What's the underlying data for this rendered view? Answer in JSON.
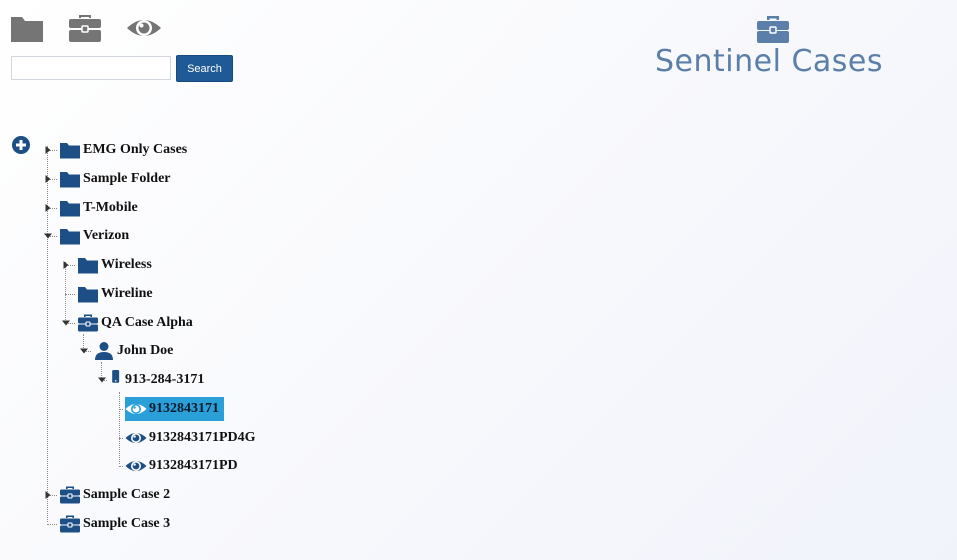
{
  "toolbar": {
    "icons": [
      "folder-icon",
      "briefcase-icon",
      "eye-icon"
    ]
  },
  "search": {
    "value": "",
    "placeholder": "",
    "button_label": "Search"
  },
  "brand": {
    "icon": "briefcase-icon",
    "title": "Sentinel Cases"
  },
  "colors": {
    "accent": "#1f5a96",
    "node_icon": "#1d4f86",
    "toolbar_icon": "#757575",
    "brand": "#5b7fa8",
    "selected_bg": "#2a9fd8"
  },
  "tree": {
    "nodes": [
      {
        "label": "EMG Only Cases",
        "icon": "folder-icon",
        "expanded": false
      },
      {
        "label": "Sample Folder",
        "icon": "folder-icon",
        "expanded": false
      },
      {
        "label": "T-Mobile",
        "icon": "folder-icon",
        "expanded": false
      },
      {
        "label": "Verizon",
        "icon": "folder-icon",
        "expanded": true
      },
      {
        "label": "Wireless",
        "icon": "folder-icon",
        "expanded": false
      },
      {
        "label": "Wireline",
        "icon": "folder-icon"
      },
      {
        "label": "QA Case Alpha",
        "icon": "briefcase-icon",
        "expanded": true
      },
      {
        "label": "John Doe",
        "icon": "user-icon",
        "expanded": true
      },
      {
        "label": "913-284-3171",
        "icon": "phone-icon",
        "expanded": true
      },
      {
        "label": "9132843171",
        "icon": "eye-icon",
        "selected": true
      },
      {
        "label": "9132843171PD4G",
        "icon": "eye-icon"
      },
      {
        "label": "9132843171PD",
        "icon": "eye-icon"
      },
      {
        "label": "Sample Case 2",
        "icon": "briefcase-icon",
        "expanded": false
      },
      {
        "label": "Sample Case 3",
        "icon": "briefcase-icon"
      }
    ]
  }
}
